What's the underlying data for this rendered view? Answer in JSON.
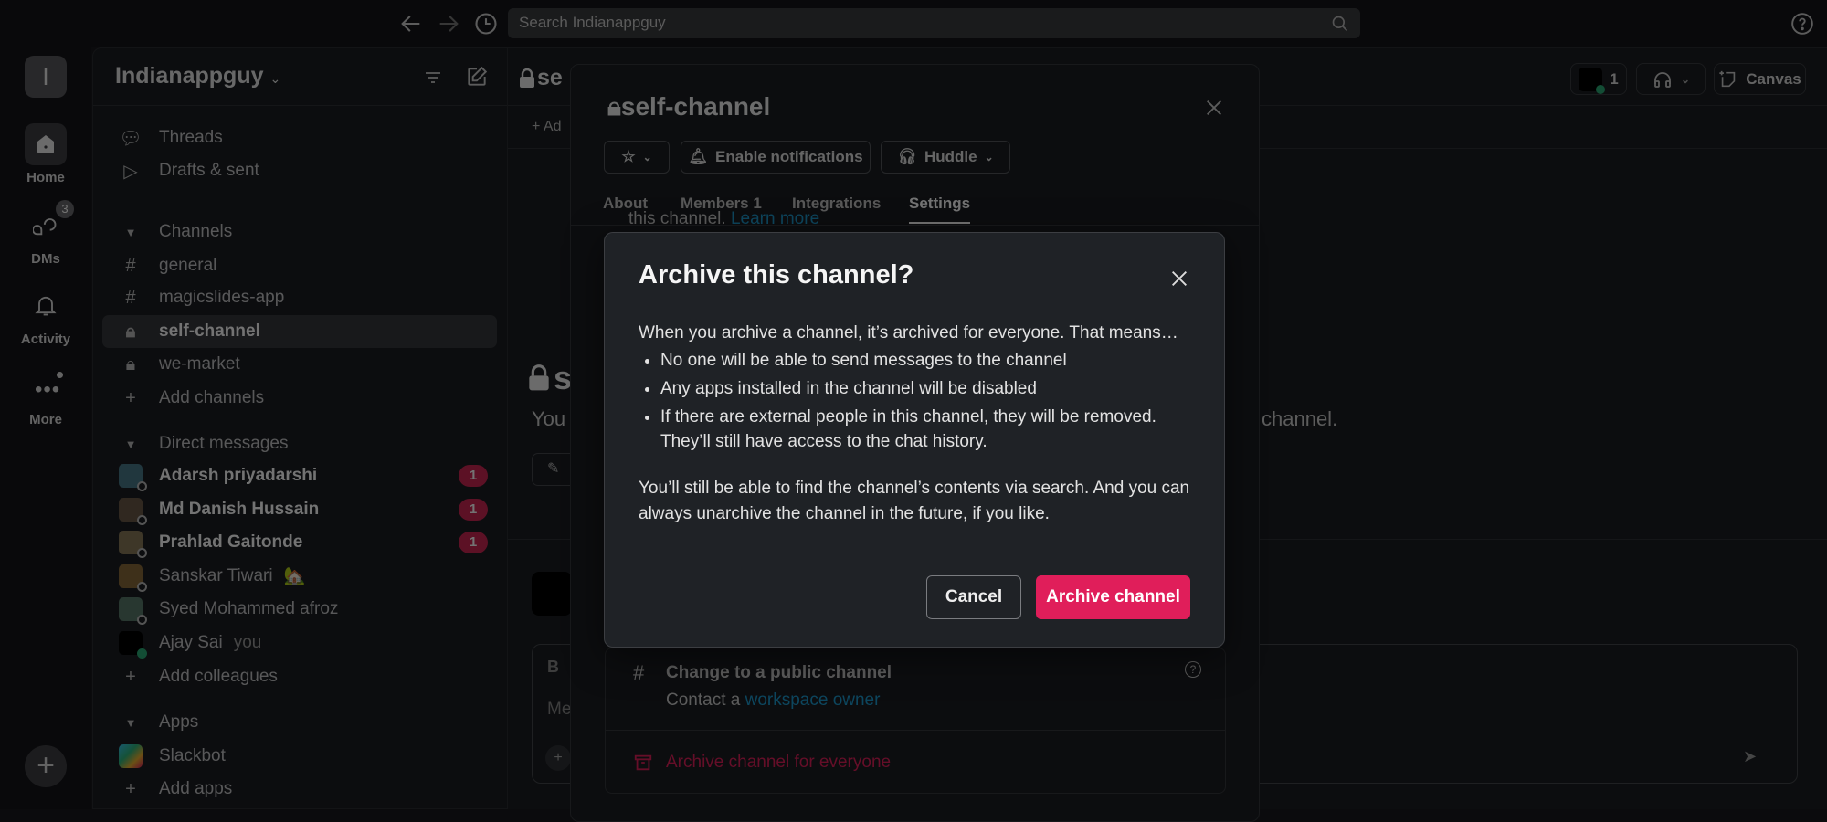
{
  "topbar": {
    "search_placeholder": "Search Indianappguy"
  },
  "rail": {
    "workspace_initial": "I",
    "home": "Home",
    "dms": "DMs",
    "dms_badge": "3",
    "activity": "Activity",
    "more": "More"
  },
  "sidebar": {
    "workspace": "Indianappguy",
    "threads": "Threads",
    "drafts": "Drafts & sent",
    "channels_header": "Channels",
    "channels": [
      {
        "name": "general",
        "icon": "hash"
      },
      {
        "name": "magicslides-app",
        "icon": "hash"
      },
      {
        "name": "self-channel",
        "icon": "lock",
        "selected": true
      },
      {
        "name": "we-market",
        "icon": "lock"
      }
    ],
    "add_channels": "Add channels",
    "dm_header": "Direct messages",
    "dms": [
      {
        "name": "Adarsh priyadarshi",
        "badge": "1",
        "unread": true
      },
      {
        "name": "Md Danish Hussain",
        "badge": "1",
        "unread": true
      },
      {
        "name": "Prahlad Gaitonde",
        "badge": "1",
        "unread": true
      },
      {
        "name": "Sanskar Tiwari",
        "status_emoji": "🏡"
      },
      {
        "name": "Syed Mohammed afroz"
      },
      {
        "name": "Ajay Sai",
        "suffix": "you",
        "online": true
      }
    ],
    "add_colleagues": "Add colleagues",
    "apps_header": "Apps",
    "apps": [
      {
        "name": "Slackbot"
      }
    ],
    "add_apps": "Add apps"
  },
  "main": {
    "channel_title_partial": "se",
    "add_bookmark_partial": "Ad",
    "intro_title_partial": "s",
    "intro_text_partial": "You",
    "intro_text_end": "channel.",
    "composer_partial": "Me",
    "format_partial": "B",
    "member_count": "1",
    "canvas_label": "Canvas"
  },
  "details": {
    "title": "self-channel",
    "enable_notifications": "Enable notifications",
    "huddle": "Huddle",
    "tabs": [
      "About",
      "Members 1",
      "Integrations",
      "Settings"
    ],
    "active_tab": "Settings",
    "peek_text": "this channel.",
    "peek_link": "Learn more",
    "change_public_title": "Change to a public channel",
    "change_public_sub": "Contact a",
    "change_public_link": "workspace owner",
    "archive_everyone": "Archive channel for everyone"
  },
  "dialog": {
    "title": "Archive this channel?",
    "intro": "When you archive a channel, it’s archived for everyone. That means…",
    "bullets": [
      "No one will be able to send messages to the channel",
      "Any apps installed in the channel will be disabled",
      "If there are external people in this channel, they will be removed. They’ll still have access to the chat history."
    ],
    "footer": "You’ll still be able to find the channel’s contents via search. And you can always unarchive the channel in the future, if you like.",
    "cancel": "Cancel",
    "confirm": "Archive channel"
  },
  "colors": {
    "danger": "#e01e5a",
    "badge": "#cd2553",
    "link": "#1d9bd1",
    "online": "#2bac76"
  }
}
